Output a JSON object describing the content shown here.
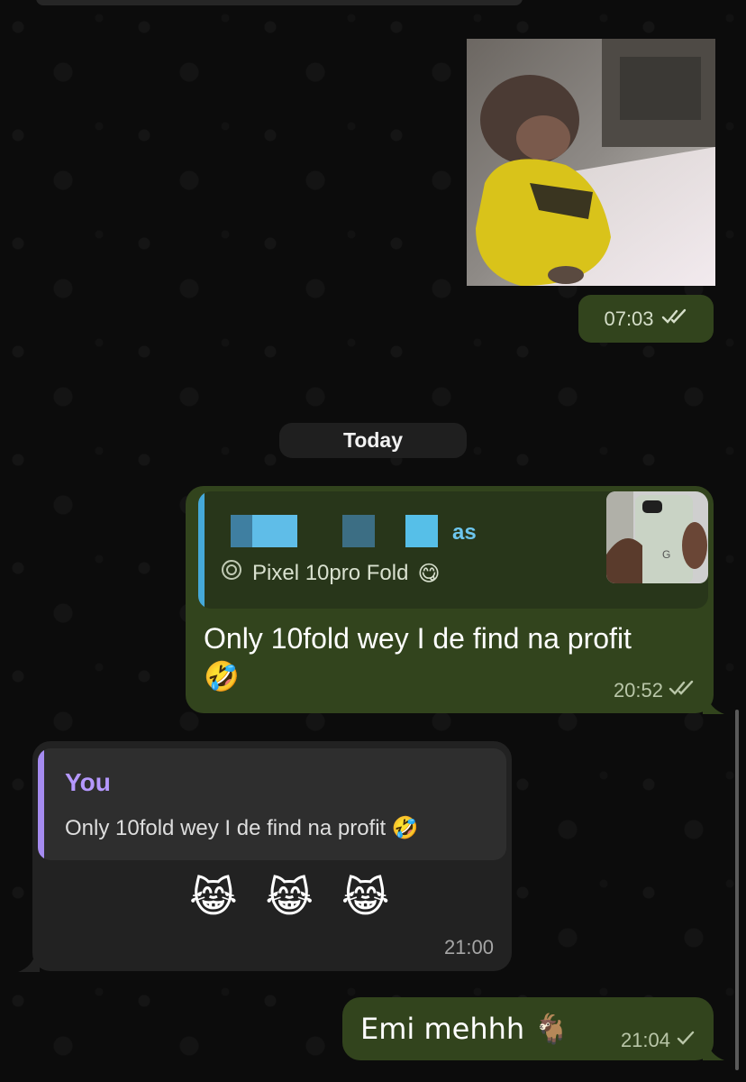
{
  "video_message": {
    "time": "07:03",
    "status_icon": "double-check-icon"
  },
  "date_separator": "Today",
  "reply_message": {
    "quoted_sender_visible": "as",
    "quoted_icon": "circle-target-icon",
    "quoted_text": "Pixel 10pro Fold",
    "quoted_emoji": "😋",
    "text": "Only 10fold wey I de find na profit",
    "text_emoji": "🤣",
    "time": "20:52",
    "status_icon": "double-check-icon"
  },
  "incoming_message": {
    "quoted_sender": "You",
    "quoted_text": "Only 10fold wey I de find na profit 🤣",
    "text": "😹 😹 😹",
    "time": "21:00"
  },
  "last_message": {
    "text": "Emi mehhh 🐐",
    "time": "21:04",
    "status_icon": "single-check-icon"
  },
  "colors": {
    "outgoing_bubble": "#32441d",
    "incoming_bubble": "#222222",
    "reply_bar_blue": "#45a9d9",
    "reply_bar_purple": "#a58bf0"
  }
}
